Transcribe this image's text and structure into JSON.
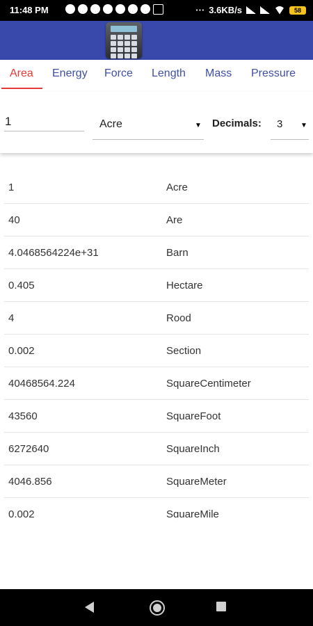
{
  "status_bar": {
    "time": "11:48 PM",
    "network_speed": "3.6KB/s",
    "battery_level": "58"
  },
  "tabs": [
    {
      "label": "Area"
    },
    {
      "label": "Energy"
    },
    {
      "label": "Force"
    },
    {
      "label": "Length"
    },
    {
      "label": "Mass"
    },
    {
      "label": "Pressure"
    }
  ],
  "active_tab": "Area",
  "colors": {
    "app_bar": "#3949ab",
    "tab_text": "#3f4fa8",
    "active_tab": "#e53935"
  },
  "converter": {
    "input_value": "1",
    "unit": "Acre",
    "decimals_label": "Decimals:",
    "decimals_value": "3"
  },
  "results": [
    {
      "value": "1",
      "unit": "Acre"
    },
    {
      "value": "40",
      "unit": "Are"
    },
    {
      "value": "4.0468564224e+31",
      "unit": "Barn"
    },
    {
      "value": "0.405",
      "unit": "Hectare"
    },
    {
      "value": "4",
      "unit": "Rood"
    },
    {
      "value": "0.002",
      "unit": "Section"
    },
    {
      "value": "40468564.224",
      "unit": "SquareCentimeter"
    },
    {
      "value": "43560",
      "unit": "SquareFoot"
    },
    {
      "value": "6272640",
      "unit": "SquareInch"
    },
    {
      "value": "4046.856",
      "unit": "SquareMeter"
    },
    {
      "value": "0.002",
      "unit": "SquareMile"
    }
  ]
}
